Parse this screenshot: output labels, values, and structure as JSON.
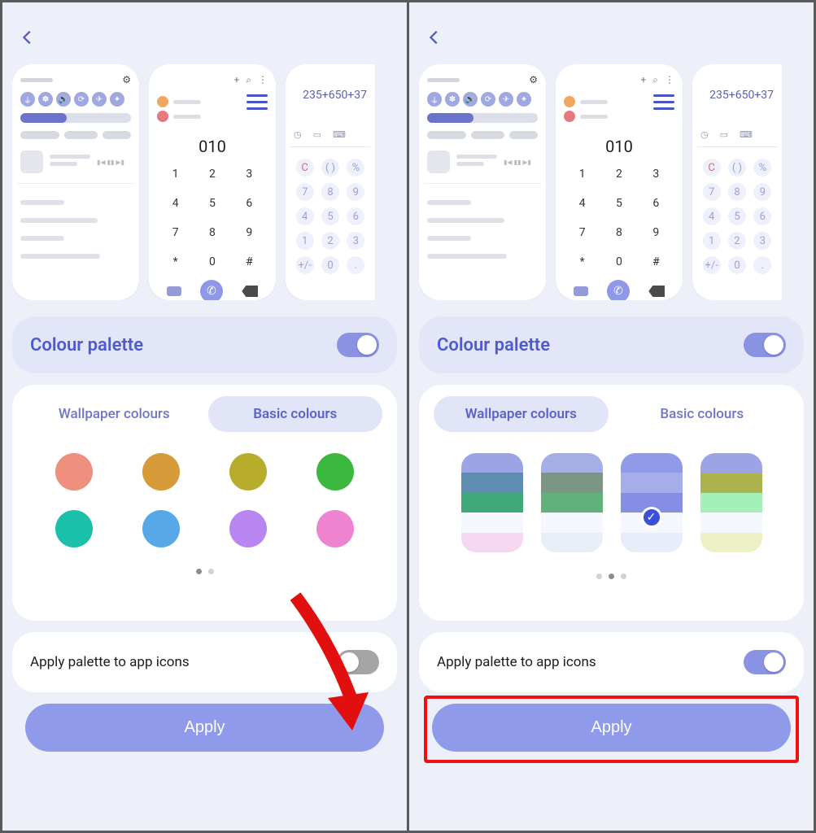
{
  "left": {
    "header": {
      "title": "Colour palette"
    },
    "tabs": {
      "wallpaper": "Wallpaper colours",
      "basic": "Basic colours",
      "active": "basic"
    },
    "basic_colours": [
      "#ee8f80",
      "#d69b38",
      "#b8ac2c",
      "#3bb83d",
      "#1bc0ab",
      "#58a8e8",
      "#b986f1",
      "#ee84d0"
    ],
    "pager_count": 2,
    "pager_active": 0,
    "apply_icons_label": "Apply palette to app icons",
    "apply_icons_on": false,
    "apply_label": "Apply",
    "palette_toggle_on": true,
    "calc_expr": "235+650+37",
    "dial_number": "010",
    "keypad": [
      "1",
      "2",
      "3",
      "4",
      "5",
      "6",
      "7",
      "8",
      "9",
      "*",
      "0",
      "#"
    ],
    "calc_keys_row1": [
      "C",
      "( )",
      "%"
    ],
    "calc_keys": [
      "7",
      "8",
      "9",
      "4",
      "5",
      "6",
      "1",
      "2",
      "3",
      "+/-",
      "0",
      "."
    ]
  },
  "right": {
    "header": {
      "title": "Colour palette"
    },
    "tabs": {
      "wallpaper": "Wallpaper colours",
      "basic": "Basic colours",
      "active": "wallpaper"
    },
    "wallpaper_cards": [
      {
        "segs": [
          "#9ba5e6",
          "#5f8cb1",
          "#3fa979",
          "#f5f7fe",
          "#f5d7f0"
        ],
        "selected": false
      },
      {
        "segs": [
          "#a6aee6",
          "#7c9686",
          "#62b07a",
          "#f5f7fe",
          "#eaeef9"
        ],
        "selected": false
      },
      {
        "segs": [
          "#8f9ae8",
          "#a5aee9",
          "#848ee4",
          "#f5f7fe",
          "#e9ecf9"
        ],
        "selected": true
      },
      {
        "segs": [
          "#9ba5e6",
          "#acb24e",
          "#a3f0b8",
          "#f5f7fe",
          "#eef0c7"
        ],
        "selected": false
      }
    ],
    "pager_count": 3,
    "pager_active": 1,
    "apply_icons_label": "Apply palette to app icons",
    "apply_icons_on": true,
    "apply_label": "Apply",
    "palette_toggle_on": true,
    "calc_expr": "235+650+37",
    "dial_number": "010",
    "keypad": [
      "1",
      "2",
      "3",
      "4",
      "5",
      "6",
      "7",
      "8",
      "9",
      "*",
      "0",
      "#"
    ],
    "calc_keys_row1": [
      "C",
      "( )",
      "%"
    ],
    "calc_keys": [
      "7",
      "8",
      "9",
      "4",
      "5",
      "6",
      "1",
      "2",
      "3",
      "+/-",
      "0",
      "."
    ]
  }
}
